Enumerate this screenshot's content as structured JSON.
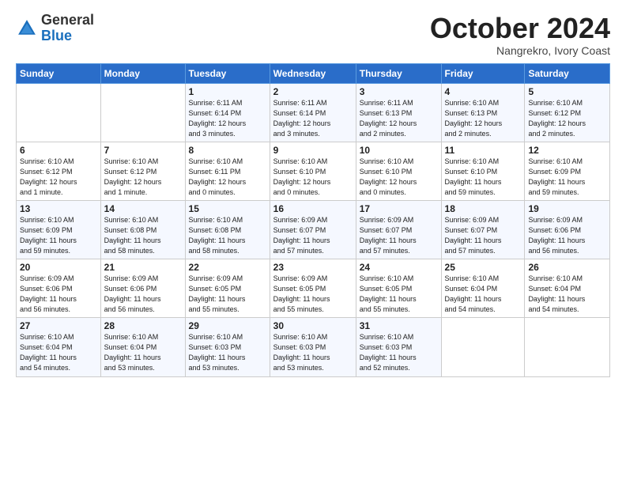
{
  "logo": {
    "general": "General",
    "blue": "Blue"
  },
  "header": {
    "month": "October 2024",
    "location": "Nangrekro, Ivory Coast"
  },
  "weekdays": [
    "Sunday",
    "Monday",
    "Tuesday",
    "Wednesday",
    "Thursday",
    "Friday",
    "Saturday"
  ],
  "weeks": [
    [
      {
        "day": "",
        "info": ""
      },
      {
        "day": "",
        "info": ""
      },
      {
        "day": "1",
        "info": "Sunrise: 6:11 AM\nSunset: 6:14 PM\nDaylight: 12 hours\nand 3 minutes."
      },
      {
        "day": "2",
        "info": "Sunrise: 6:11 AM\nSunset: 6:14 PM\nDaylight: 12 hours\nand 3 minutes."
      },
      {
        "day": "3",
        "info": "Sunrise: 6:11 AM\nSunset: 6:13 PM\nDaylight: 12 hours\nand 2 minutes."
      },
      {
        "day": "4",
        "info": "Sunrise: 6:10 AM\nSunset: 6:13 PM\nDaylight: 12 hours\nand 2 minutes."
      },
      {
        "day": "5",
        "info": "Sunrise: 6:10 AM\nSunset: 6:12 PM\nDaylight: 12 hours\nand 2 minutes."
      }
    ],
    [
      {
        "day": "6",
        "info": "Sunrise: 6:10 AM\nSunset: 6:12 PM\nDaylight: 12 hours\nand 1 minute."
      },
      {
        "day": "7",
        "info": "Sunrise: 6:10 AM\nSunset: 6:12 PM\nDaylight: 12 hours\nand 1 minute."
      },
      {
        "day": "8",
        "info": "Sunrise: 6:10 AM\nSunset: 6:11 PM\nDaylight: 12 hours\nand 0 minutes."
      },
      {
        "day": "9",
        "info": "Sunrise: 6:10 AM\nSunset: 6:10 PM\nDaylight: 12 hours\nand 0 minutes."
      },
      {
        "day": "10",
        "info": "Sunrise: 6:10 AM\nSunset: 6:10 PM\nDaylight: 12 hours\nand 0 minutes."
      },
      {
        "day": "11",
        "info": "Sunrise: 6:10 AM\nSunset: 6:10 PM\nDaylight: 11 hours\nand 59 minutes."
      },
      {
        "day": "12",
        "info": "Sunrise: 6:10 AM\nSunset: 6:09 PM\nDaylight: 11 hours\nand 59 minutes."
      }
    ],
    [
      {
        "day": "13",
        "info": "Sunrise: 6:10 AM\nSunset: 6:09 PM\nDaylight: 11 hours\nand 59 minutes."
      },
      {
        "day": "14",
        "info": "Sunrise: 6:10 AM\nSunset: 6:08 PM\nDaylight: 11 hours\nand 58 minutes."
      },
      {
        "day": "15",
        "info": "Sunrise: 6:10 AM\nSunset: 6:08 PM\nDaylight: 11 hours\nand 58 minutes."
      },
      {
        "day": "16",
        "info": "Sunrise: 6:09 AM\nSunset: 6:07 PM\nDaylight: 11 hours\nand 57 minutes."
      },
      {
        "day": "17",
        "info": "Sunrise: 6:09 AM\nSunset: 6:07 PM\nDaylight: 11 hours\nand 57 minutes."
      },
      {
        "day": "18",
        "info": "Sunrise: 6:09 AM\nSunset: 6:07 PM\nDaylight: 11 hours\nand 57 minutes."
      },
      {
        "day": "19",
        "info": "Sunrise: 6:09 AM\nSunset: 6:06 PM\nDaylight: 11 hours\nand 56 minutes."
      }
    ],
    [
      {
        "day": "20",
        "info": "Sunrise: 6:09 AM\nSunset: 6:06 PM\nDaylight: 11 hours\nand 56 minutes."
      },
      {
        "day": "21",
        "info": "Sunrise: 6:09 AM\nSunset: 6:06 PM\nDaylight: 11 hours\nand 56 minutes."
      },
      {
        "day": "22",
        "info": "Sunrise: 6:09 AM\nSunset: 6:05 PM\nDaylight: 11 hours\nand 55 minutes."
      },
      {
        "day": "23",
        "info": "Sunrise: 6:09 AM\nSunset: 6:05 PM\nDaylight: 11 hours\nand 55 minutes."
      },
      {
        "day": "24",
        "info": "Sunrise: 6:10 AM\nSunset: 6:05 PM\nDaylight: 11 hours\nand 55 minutes."
      },
      {
        "day": "25",
        "info": "Sunrise: 6:10 AM\nSunset: 6:04 PM\nDaylight: 11 hours\nand 54 minutes."
      },
      {
        "day": "26",
        "info": "Sunrise: 6:10 AM\nSunset: 6:04 PM\nDaylight: 11 hours\nand 54 minutes."
      }
    ],
    [
      {
        "day": "27",
        "info": "Sunrise: 6:10 AM\nSunset: 6:04 PM\nDaylight: 11 hours\nand 54 minutes."
      },
      {
        "day": "28",
        "info": "Sunrise: 6:10 AM\nSunset: 6:04 PM\nDaylight: 11 hours\nand 53 minutes."
      },
      {
        "day": "29",
        "info": "Sunrise: 6:10 AM\nSunset: 6:03 PM\nDaylight: 11 hours\nand 53 minutes."
      },
      {
        "day": "30",
        "info": "Sunrise: 6:10 AM\nSunset: 6:03 PM\nDaylight: 11 hours\nand 53 minutes."
      },
      {
        "day": "31",
        "info": "Sunrise: 6:10 AM\nSunset: 6:03 PM\nDaylight: 11 hours\nand 52 minutes."
      },
      {
        "day": "",
        "info": ""
      },
      {
        "day": "",
        "info": ""
      }
    ]
  ]
}
